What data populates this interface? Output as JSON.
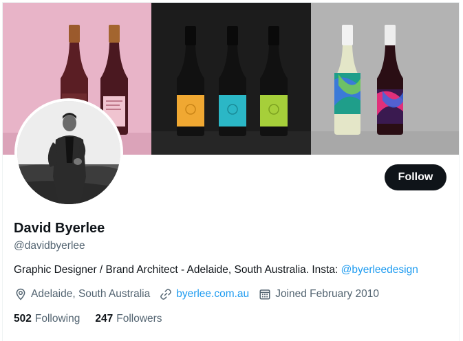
{
  "profile": {
    "display_name": "David Byerlee",
    "handle": "@davidbyerlee",
    "bio_text": "Graphic Designer / Brand Architect - Adelaide, South Australia. Insta: ",
    "bio_link": "@byerleedesign",
    "location": "Adelaide, South Australia",
    "website": "byerlee.com.au",
    "joined": "Joined February 2010",
    "following_count": "502",
    "following_label": "Following",
    "followers_count": "247",
    "followers_label": "Followers"
  },
  "actions": {
    "follow_label": "Follow"
  },
  "icons": {
    "location": "location-pin-icon",
    "website": "link-icon",
    "joined": "calendar-icon"
  },
  "colors": {
    "link": "#1d9bf0",
    "button_bg": "#0f1419",
    "secondary_text": "#536471"
  }
}
